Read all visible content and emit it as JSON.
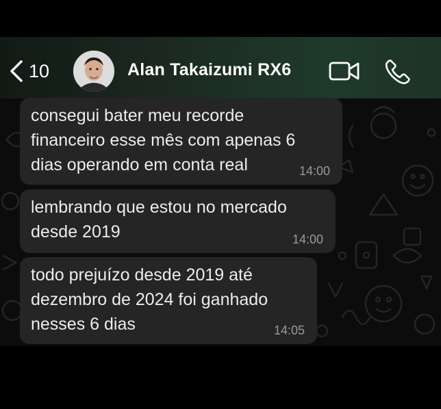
{
  "header": {
    "back_count": "10",
    "contact_name": "Alan Takaizumi RX6",
    "icons": {
      "back": "chevron-left-icon",
      "video": "video-camera-icon",
      "call": "phone-icon"
    }
  },
  "messages": [
    {
      "text": "consegui bater meu recorde\nfinanceiro esse mês com apenas 6\ndias operando em conta real",
      "time": "14:00"
    },
    {
      "text": "lembrando que estou no mercado\ndesde 2019",
      "time": "14:00"
    },
    {
      "text": "todo prejuízo desde 2019 até\ndezembro de 2024 foi ganhado\nnesses 6 dias",
      "time": "14:05"
    }
  ],
  "colors": {
    "background": "#000000",
    "chat_background": "#0c0c0c",
    "bubble": "#252525",
    "header_accent": "#1f3a2b",
    "text": "#ececec",
    "timestamp": "#9a9a9a"
  }
}
